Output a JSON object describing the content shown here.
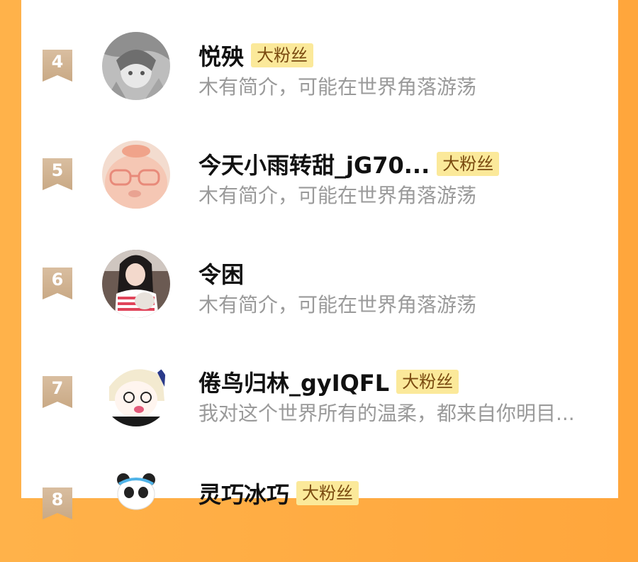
{
  "accent_colors": {
    "background": "#ffa63c",
    "badge_bg": "#fbe99a",
    "badge_text": "#7a4a10",
    "rank_ribbon": "#d2b390"
  },
  "fans": [
    {
      "rank": "4",
      "name": "悦殃",
      "badge": "大粉丝",
      "bio": "木有简介，可能在世界角落游荡",
      "avatar_icon": "avatar-sketch-girl"
    },
    {
      "rank": "5",
      "name": "今天小雨转甜_jG70...",
      "badge": "大粉丝",
      "bio": "木有简介，可能在世界角落游荡",
      "avatar_icon": "avatar-pig-glasses"
    },
    {
      "rank": "6",
      "name": "令困",
      "badge": "",
      "bio": "木有简介，可能在世界角落游荡",
      "avatar_icon": "avatar-girl-cat"
    },
    {
      "rank": "7",
      "name": "倦鸟归林_gyIQFL",
      "badge": "大粉丝",
      "bio": "我对这个世界所有的温柔，都来自你明目...",
      "avatar_icon": "avatar-anime-character"
    },
    {
      "rank": "8",
      "name": "灵巧冰巧",
      "badge": "大粉丝",
      "bio": "",
      "avatar_icon": "avatar-panda"
    }
  ]
}
